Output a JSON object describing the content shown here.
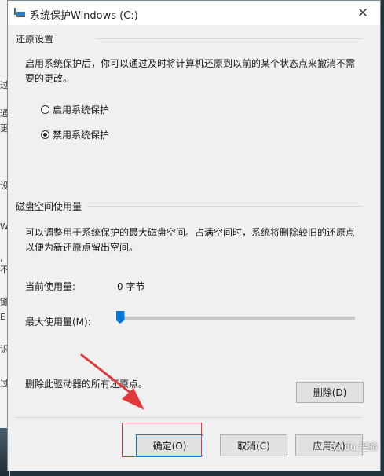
{
  "background_fragments": [
    "过",
    "通",
    "更",
    "设",
    "W",
    ", 不",
    "键",
    "E",
    "识",
    "过"
  ],
  "dialog": {
    "title": "系统保护Windows (C:)",
    "close_label": "✕"
  },
  "restore": {
    "section_title": "还原设置",
    "description": "启用系统保护后，你可以通过及时将计算机还原到以前的某个状态点来撤消不需要的更改。",
    "options": [
      {
        "label": "启用系统保护",
        "checked": false
      },
      {
        "label": "禁用系统保护",
        "checked": true
      }
    ]
  },
  "disk": {
    "section_title": "磁盘空间使用量",
    "description": "可以调整用于系统保护的最大磁盘空间。占满空间时，系统将删除较旧的还原点以便为新还原点留出空间。",
    "current_label": "当前使用量:",
    "current_value": "0 字节",
    "max_label": "最大使用量(M):",
    "max_usage_fraction": 0.0
  },
  "delete": {
    "description": "删除此驱动器的所有还原点。",
    "button_label": "删除(D)"
  },
  "footer": {
    "ok_label": "确定(O)",
    "cancel_label": "取消(C)",
    "apply_label": "应用(A)"
  },
  "annotation": {
    "color": "#e03a3a"
  },
  "watermark": "Baidu 经验"
}
